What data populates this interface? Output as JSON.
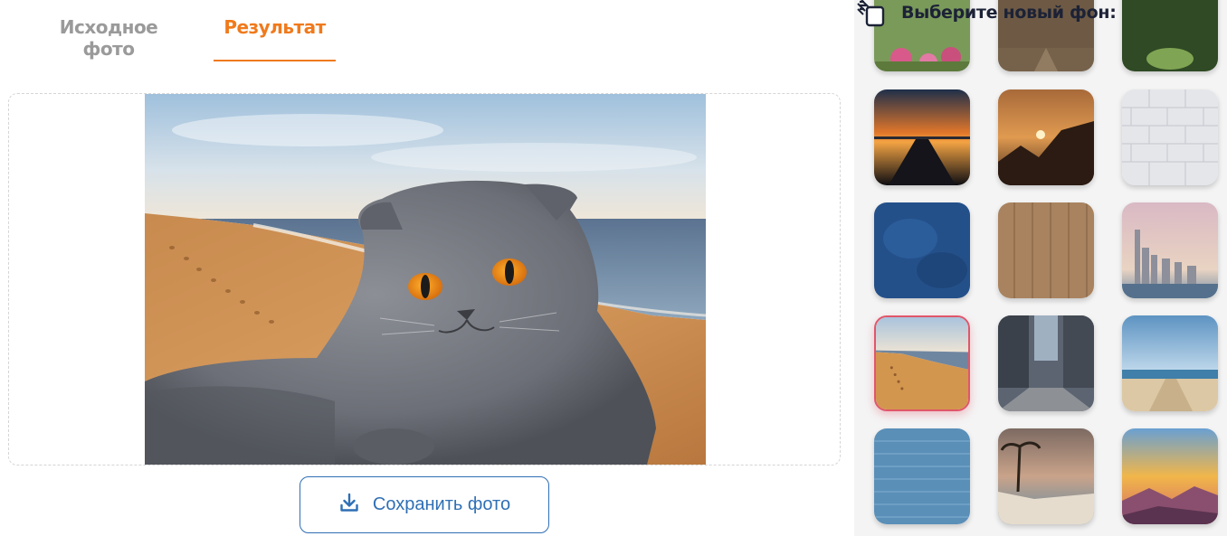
{
  "tabs": {
    "source_label": "Исходное фото",
    "result_label": "Результат",
    "active": "result"
  },
  "save_button": {
    "label": "Сохранить фото",
    "icon": "download-icon"
  },
  "background_panel": {
    "title": "Выберите новый фон:",
    "icon": "layers-icon",
    "selected_index": 9,
    "thumbnails": [
      {
        "name": "flower-garden"
      },
      {
        "name": "forest-path"
      },
      {
        "name": "green-tunnel"
      },
      {
        "name": "sunset-pier"
      },
      {
        "name": "mountain-sunset"
      },
      {
        "name": "white-brick-wall"
      },
      {
        "name": "blue-texture"
      },
      {
        "name": "wood-planks"
      },
      {
        "name": "city-skyline"
      },
      {
        "name": "beach-footprints"
      },
      {
        "name": "city-street"
      },
      {
        "name": "beach-boardwalk"
      },
      {
        "name": "blue-brick-wall"
      },
      {
        "name": "tropical-coast"
      },
      {
        "name": "mountain-sky"
      }
    ]
  },
  "colors": {
    "accent_orange": "#f07a1c",
    "button_blue": "#2f6fb5",
    "selected_border": "#e0566a",
    "panel_bg": "#f4f4f4"
  }
}
